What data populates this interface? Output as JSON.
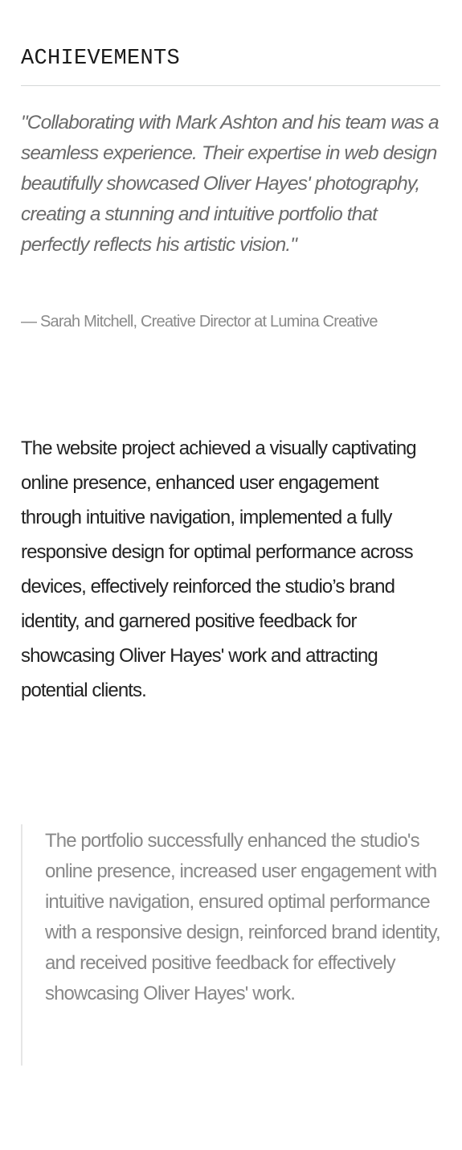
{
  "section": {
    "heading": "ACHIEVEMENTS",
    "testimonial": {
      "quote": "\"Collaborating with Mark Ashton and his team was a seamless experience. Their expertise in web design beautifully showcased Oliver Hayes' photography, creating a stunning and intuitive portfolio that perfectly reflects his artistic vision.\"",
      "attribution": "— Sarah Mitchell, Creative Director at Lumina Creative"
    },
    "summary": "The website project achieved a visually captivating online presence, enhanced user engagement through intuitive navigation, implemented a fully responsive design for optimal performance across devices, effectively reinforced the studio’s brand identity, and garnered positive feedback for showcasing Oliver Hayes' work and attracting potential clients.",
    "highlight": "The portfolio successfully enhanced the studio's online presence, increased user engagement with intuitive navigation, ensured optimal performance with a responsive design, reinforced brand identity, and received positive feedback for effectively showcasing Oliver Hayes' work."
  }
}
